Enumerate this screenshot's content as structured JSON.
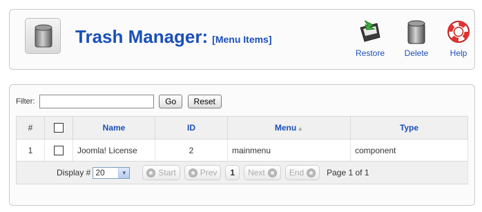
{
  "header": {
    "title": "Trash Manager:",
    "subtitle": "[Menu Items]"
  },
  "toolbar": {
    "restore_label": "Restore",
    "delete_label": "Delete",
    "help_label": "Help"
  },
  "filter": {
    "label": "Filter:",
    "value": "",
    "go_label": "Go",
    "reset_label": "Reset"
  },
  "table": {
    "headers": {
      "num": "#",
      "name": "Name",
      "id": "ID",
      "menu": "Menu",
      "type": "Type"
    },
    "rows": [
      {
        "num": "1",
        "name": "Joomla! License",
        "id": "2",
        "menu": "mainmenu",
        "type": "component"
      }
    ]
  },
  "pagination": {
    "display_label": "Display #",
    "display_value": "20",
    "start_label": "Start",
    "prev_label": "Prev",
    "current_page": "1",
    "next_label": "Next",
    "end_label": "End",
    "page_info": "Page 1 of 1"
  },
  "colors": {
    "accent": "#1a4fb8",
    "header_bg": "#f0f0f0",
    "border": "#c9c9c9"
  },
  "icons": {
    "header": "trash-can-icon",
    "restore": "restore-bin-icon",
    "delete": "trash-can-icon",
    "help": "lifebuoy-icon",
    "sort": "sort-ascending-icon"
  }
}
